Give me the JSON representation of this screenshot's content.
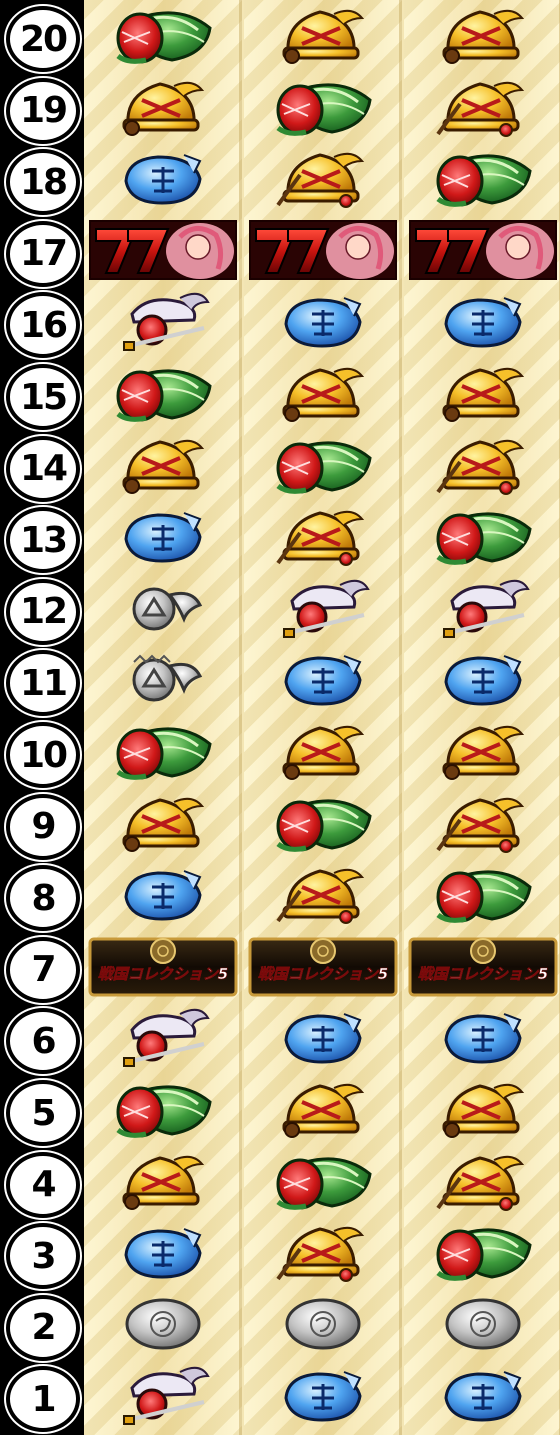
{
  "row_numbers": [
    "20",
    "19",
    "18",
    "17",
    "16",
    "15",
    "14",
    "13",
    "12",
    "11",
    "10",
    "9",
    "8",
    "7",
    "6",
    "5",
    "4",
    "3",
    "2",
    "1"
  ],
  "reels": [
    [
      "watermelon-icon",
      "bell-icon",
      "replay-blue-icon",
      "seven-icon",
      "samurai-helmet-icon",
      "watermelon-icon",
      "bell-icon",
      "replay-blue-icon",
      "silver-helmet-icon",
      "silver-crest-icon",
      "watermelon-icon",
      "bell-icon",
      "replay-blue-icon",
      "bar-icon",
      "samurai-helmet-icon",
      "watermelon-icon",
      "bell-icon",
      "replay-blue-icon",
      "silver-coin-icon",
      "samurai-helmet-icon"
    ],
    [
      "bell-icon",
      "watermelon-icon",
      "cherry-bell-icon",
      "seven-icon",
      "replay-blue-icon",
      "bell-icon",
      "watermelon-icon",
      "cherry-bell-icon",
      "samurai-helmet-icon",
      "replay-blue-icon",
      "bell-icon",
      "watermelon-icon",
      "cherry-bell-icon",
      "bar-icon",
      "replay-blue-icon",
      "bell-icon",
      "watermelon-icon",
      "cherry-bell-icon",
      "silver-coin-icon",
      "replay-blue-icon"
    ],
    [
      "bell-icon",
      "cherry-bell-icon",
      "watermelon-icon",
      "seven-icon",
      "replay-blue-icon",
      "bell-icon",
      "cherry-bell-icon",
      "watermelon-icon",
      "samurai-helmet-icon",
      "replay-blue-icon",
      "bell-icon",
      "cherry-bell-icon",
      "watermelon-icon",
      "bar-icon",
      "replay-blue-icon",
      "bell-icon",
      "cherry-bell-icon",
      "watermelon-icon",
      "silver-coin-icon",
      "replay-blue-icon"
    ]
  ],
  "bar_text": "戦国コレクション5",
  "colors": {
    "background": "#000000",
    "reel_bg": "#f4e6b4",
    "seven_red": "#c8140f",
    "bell_gold": "#f2b01e",
    "watermelon_green": "#2f8a34",
    "replay_blue": "#3d8ee8",
    "silver": "#b8b8b8"
  }
}
